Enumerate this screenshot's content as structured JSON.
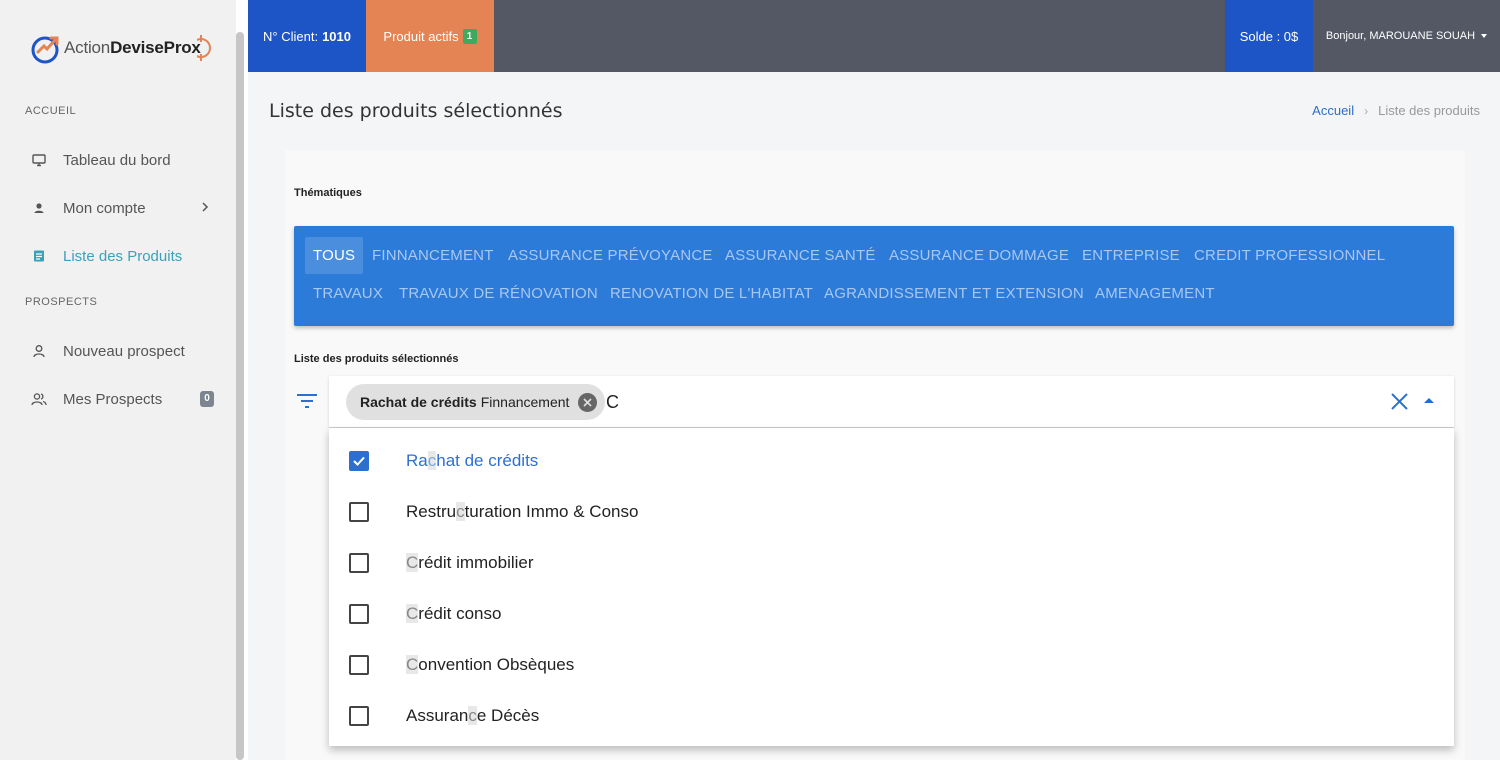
{
  "app": {
    "logo": {
      "text_regular": "Action",
      "text_bold": "DeviseProx"
    }
  },
  "sidebar": {
    "section_accueil": "ACCUEIL",
    "section_prospects": "PROSPECTS",
    "items": [
      {
        "label": "Tableau du bord",
        "icon": "monitor-icon"
      },
      {
        "label": "Mon compte",
        "icon": "person-icon"
      },
      {
        "label": "Liste des Produits",
        "icon": "list-icon",
        "active": true
      },
      {
        "label": "Nouveau prospect",
        "icon": "person-outline-icon"
      },
      {
        "label": "Mes Prospects",
        "icon": "people-icon",
        "badge": "0"
      }
    ]
  },
  "topbar": {
    "client_label": "N° Client:",
    "client_number": "1010",
    "products_label": "Produit actifs",
    "products_count": "1",
    "solde": "Solde : 0$",
    "greeting": "Bonjour, MAROUANE SOUAH"
  },
  "header": {
    "title": "Liste des produits sélectionnés",
    "breadcrumb": {
      "home": "Accueil",
      "current": "Liste des produits"
    }
  },
  "thematiques": {
    "label": "Thématiques",
    "items": [
      "TOUS",
      "FINNANCEMENT",
      "ASSURANCE PRÉVOYANCE",
      "ASSURANCE SANTÉ",
      "ASSURANCE DOMMAGE",
      "ENTREPRISE",
      "CREDIT PROFESSIONNEL",
      "TRAVAUX",
      "TRAVAUX DE RÉNOVATION",
      "RENOVATION DE L'HABITAT",
      "AGRANDISSEMENT ET EXTENSION",
      "AMENAGEMENT"
    ],
    "active": "TOUS"
  },
  "product_select": {
    "label": "Liste des produits sélectionnés",
    "chip": {
      "name": "Rachat de crédits",
      "category": "Finnancement"
    },
    "input_value": "C",
    "options": [
      {
        "label": "Rachat de crédits",
        "checked": true
      },
      {
        "label": "Restructuration Immo & Conso",
        "checked": false
      },
      {
        "label": "Crédit immobilier",
        "checked": false
      },
      {
        "label": "Crédit conso",
        "checked": false
      },
      {
        "label": "Convention Obsèques",
        "checked": false
      },
      {
        "label": "Assurance Décès",
        "checked": false
      }
    ]
  },
  "colors": {
    "primary_blue": "#1d55c7",
    "theme_bar": "#2d7bd9",
    "products_orange": "#e48454",
    "topbar_gray": "#545865",
    "active_teal": "#3aa1b8",
    "badge_green": "#41a85f"
  }
}
